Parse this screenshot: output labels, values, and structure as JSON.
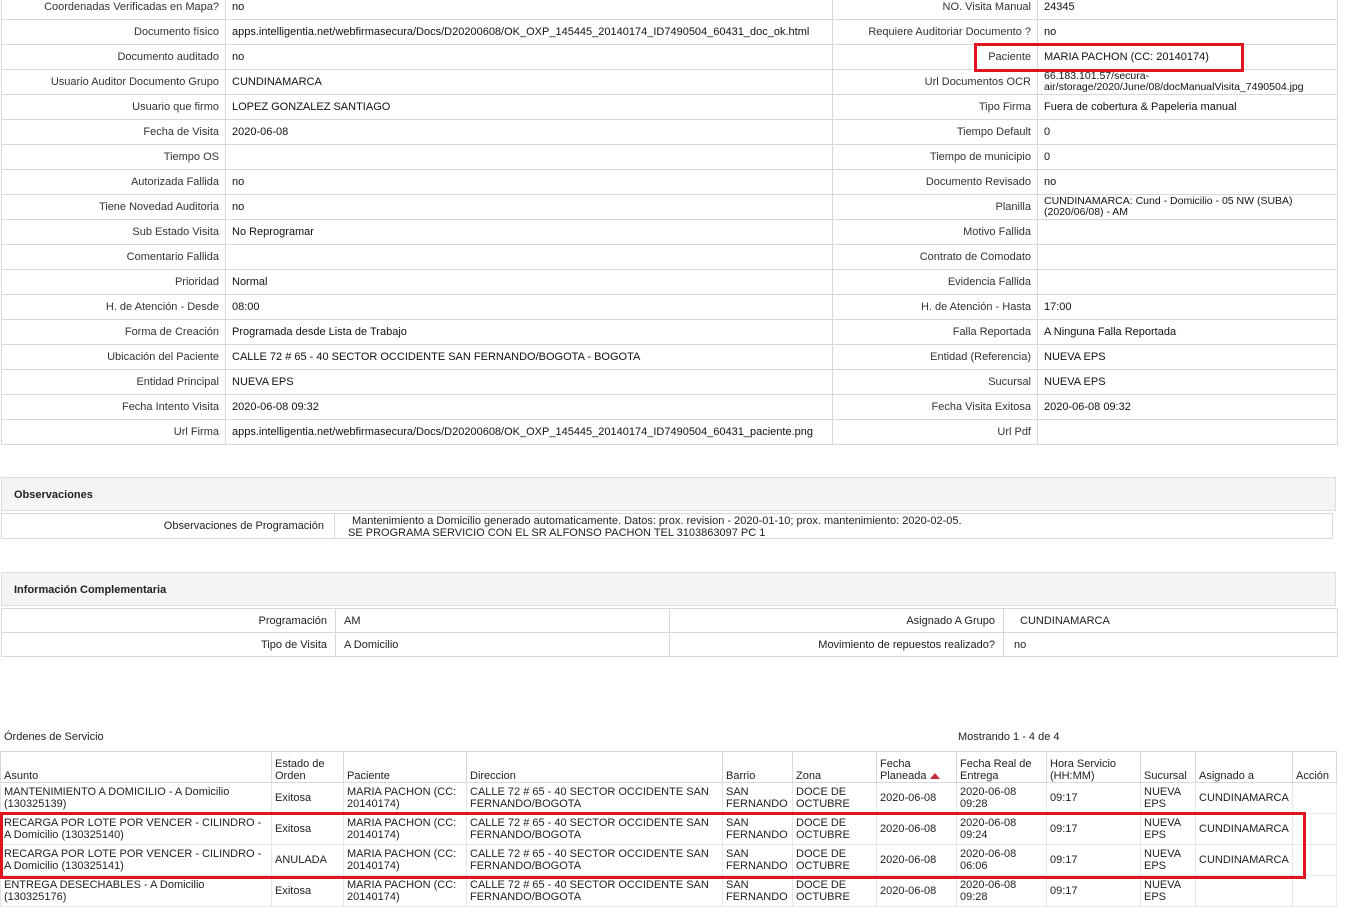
{
  "detail_rows": [
    {
      "l1": "Coordenadas Verificadas en Mapa?",
      "v1": "no",
      "l2": "NO. Visita Manual",
      "v2": "24345"
    },
    {
      "l1": "Documento físico",
      "v1": "apps.intelligentia.net/webfirmasecura/Docs/D20200608/OK_OXP_145445_20140174_ID7490504_60431_doc_ok.html",
      "l2": "Requiere Auditoriar Documento ?",
      "v2": "no"
    },
    {
      "l1": "Documento auditado",
      "v1": "no",
      "l2": "Paciente",
      "v2": "MARIA PACHON (CC: 20140174)"
    },
    {
      "l1": "Usuario Auditor Documento Grupo",
      "v1": " CUNDINAMARCA",
      "l2": "Url Documentos OCR",
      "v2": "66.183.101.57/secura-air/storage/2020/June/08/docManualVisita_7490504.jpg"
    },
    {
      "l1": "Usuario que firmo",
      "v1": "LOPEZ GONZALEZ SANTIAGO",
      "l2": "Tipo Firma",
      "v2": " Fuera de cobertura & Papeleria manual"
    },
    {
      "l1": "Fecha de Visita",
      "v1": "2020-06-08",
      "l2": "Tiempo Default",
      "v2": "0"
    },
    {
      "l1": "Tiempo OS",
      "v1": "",
      "l2": "Tiempo de municipio",
      "v2": "0"
    },
    {
      "l1": "Autorizada Fallida",
      "v1": "no",
      "l2": "Documento Revisado",
      "v2": "no"
    },
    {
      "l1": "Tiene Novedad Auditoria",
      "v1": "no",
      "l2": "Planilla",
      "v2": "CUNDINAMARCA: Cund - Domicilio - 05 NW (SUBA) (2020/06/08) - AM"
    },
    {
      "l1": "Sub Estado Visita",
      "v1": " No Reprogramar",
      "l2": "Motivo Fallida",
      "v2": ""
    },
    {
      "l1": "Comentario Fallida",
      "v1": "",
      "l2": "Contrato de Comodato",
      "v2": ""
    },
    {
      "l1": "Prioridad",
      "v1": " Normal",
      "l2": "Evidencia Fallida",
      "v2": ""
    },
    {
      "l1": "H. de Atención - Desde",
      "v1": " 08:00",
      "l2": "H. de Atención - Hasta",
      "v2": " 17:00"
    },
    {
      "l1": "Forma de Creación",
      "v1": " Programada desde Lista de Trabajo",
      "l2": "Falla Reportada",
      "v2": " A Ninguna Falla Reportada"
    },
    {
      "l1": "Ubicación del Paciente",
      "v1": "CALLE 72 # 65 - 40 SECTOR OCCIDENTE SAN FERNANDO/BOGOTA - BOGOTA",
      "l2": "Entidad (Referencia)",
      "v2": "NUEVA EPS"
    },
    {
      "l1": "Entidad Principal",
      "v1": " NUEVA EPS",
      "l2": "Sucursal",
      "v2": " NUEVA EPS"
    },
    {
      "l1": "Fecha Intento Visita",
      "v1": "2020-06-08 09:32",
      "l2": "Fecha Visita Exitosa",
      "v2": "2020-06-08 09:32"
    },
    {
      "l1": "Url Firma",
      "v1": "apps.intelligentia.net/webfirmasecura/Docs/D20200608/OK_OXP_145445_20140174_ID7490504_60431_paciente.png",
      "l2": "Url Pdf",
      "v2": ""
    }
  ],
  "observaciones": {
    "title": "Observaciones",
    "label": "Observaciones de Programación",
    "line1": "Mantenimiento a Domicilio generado automaticamente. Datos: prox. revision - 2020-01-10; prox. mantenimiento: 2020-02-05.",
    "line2": "SE PROGRAMA SERVICIO CON EL SR ALFONSO PACHON TEL 3103863097 PC 1"
  },
  "complementaria": {
    "title": "Información Complementaria",
    "programacion_label": "Programación",
    "programacion": "AM",
    "grupo_label": "Asignado A Grupo",
    "grupo": "CUNDINAMARCA",
    "tipo_label": "Tipo de Visita",
    "tipo": "A Domicilio",
    "repuestos_label": "Movimiento de repuestos realizado?",
    "repuestos": "no"
  },
  "ordenes": {
    "title": "Órdenes de Servicio",
    "showing": "Mostrando 1 - 4 de 4",
    "headers": [
      "Asunto",
      "Estado de Orden",
      "Paciente",
      "Direccion",
      "Barrio",
      "Zona",
      "Fecha Planeada",
      "Fecha Real de Entrega",
      "Hora Servicio (HH:MM)",
      "Sucursal",
      "Asignado a",
      "Acción"
    ],
    "rows": [
      {
        "asunto": "MANTENIMIENTO A DOMICILIO - A Domicilio (130325139)",
        "estado": "Exitosa",
        "paciente": "MARIA PACHON (CC: 20140174)",
        "direccion": "CALLE 72 # 65 - 40 SECTOR OCCIDENTE SAN FERNANDO/BOGOTA",
        "barrio": "SAN FERNANDO",
        "zona": "DOCE DE OCTUBRE",
        "planeada": "2020-06-08",
        "real": "2020-06-08 09:28",
        "hora": "09:17",
        "sucursal": "NUEVA EPS",
        "asignado": "CUNDINAMARCA"
      },
      {
        "asunto": "RECARGA POR LOTE POR VENCER - CILINDRO - A Domicilio (130325140)",
        "estado": "Exitosa",
        "paciente": "MARIA PACHON (CC: 20140174)",
        "direccion": "CALLE 72 # 65 - 40 SECTOR OCCIDENTE SAN FERNANDO/BOGOTA",
        "barrio": "SAN FERNANDO",
        "zona": "DOCE DE OCTUBRE",
        "planeada": "2020-06-08",
        "real": "2020-06-08 09:24",
        "hora": "09:17",
        "sucursal": "NUEVA EPS",
        "asignado": "CUNDINAMARCA"
      },
      {
        "asunto": "RECARGA POR LOTE POR VENCER - CILINDRO - A Domicilio (130325141)",
        "estado": "ANULADA",
        "paciente": "MARIA PACHON (CC: 20140174)",
        "direccion": "CALLE 72 # 65 - 40 SECTOR OCCIDENTE SAN FERNANDO/BOGOTA",
        "barrio": "SAN FERNANDO",
        "zona": "DOCE DE OCTUBRE",
        "planeada": "2020-06-08",
        "real": "2020-06-08 06:06",
        "hora": "09:17",
        "sucursal": "NUEVA EPS",
        "asignado": "CUNDINAMARCA"
      },
      {
        "asunto": "ENTREGA DESECHABLES - A Domicilio (130325176)",
        "estado": "Exitosa",
        "paciente": "MARIA PACHON (CC: 20140174)",
        "direccion": "CALLE 72 # 65 - 40 SECTOR OCCIDENTE SAN FERNANDO/BOGOTA",
        "barrio": "SAN FERNANDO",
        "zona": "DOCE DE OCTUBRE",
        "planeada": "2020-06-08",
        "real": "2020-06-08 09:28",
        "hora": "09:17",
        "sucursal": "NUEVA EPS",
        "asignado": ""
      }
    ]
  },
  "colors": {
    "highlight": "#e0141e",
    "sort_arrow": "#c0303a"
  }
}
